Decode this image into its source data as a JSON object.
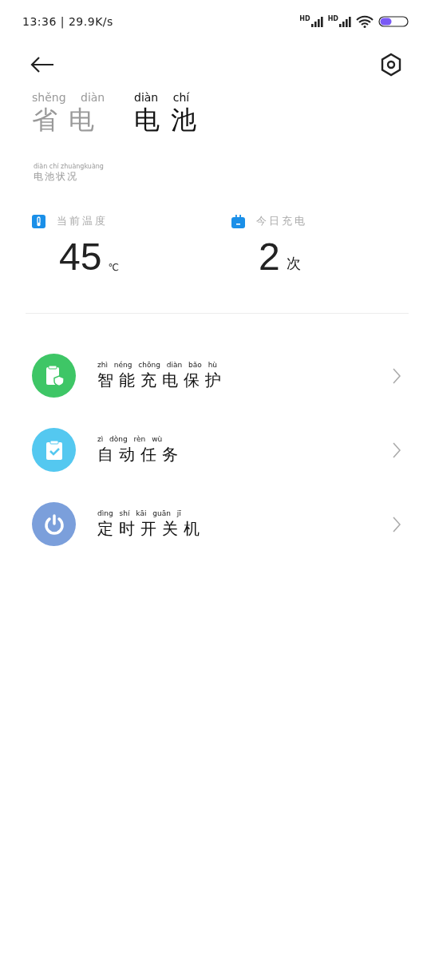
{
  "status_bar": {
    "time": "13:36 | 29.9K/s",
    "signals": [
      "HD",
      "HD"
    ]
  },
  "tabs": [
    {
      "pinyin": "shěng diàn",
      "label": "省电",
      "selected": false
    },
    {
      "pinyin": "diàn chí",
      "label": "电池",
      "selected": true
    }
  ],
  "section": {
    "pinyin": "diàn chí zhuàngkuàng",
    "label": "电池状况"
  },
  "stats": [
    {
      "kind": "temperature",
      "label": "当前温度",
      "value": "45",
      "unit": "℃"
    },
    {
      "kind": "charge",
      "label": "今日充电",
      "value": "2",
      "unit": "次"
    }
  ],
  "menu": [
    {
      "kind": "protect",
      "color": "#3ec666",
      "pinyin": "zhì néng chōng diàn bǎo hù",
      "label": "智能充电保护"
    },
    {
      "kind": "task",
      "color": "#54c8f0",
      "pinyin": "zì dòng rèn wù",
      "label": "自动任务"
    },
    {
      "kind": "power",
      "color": "#7b9fdb",
      "pinyin": "dìng shí kāi guān jī",
      "label": "定时开关机"
    }
  ]
}
